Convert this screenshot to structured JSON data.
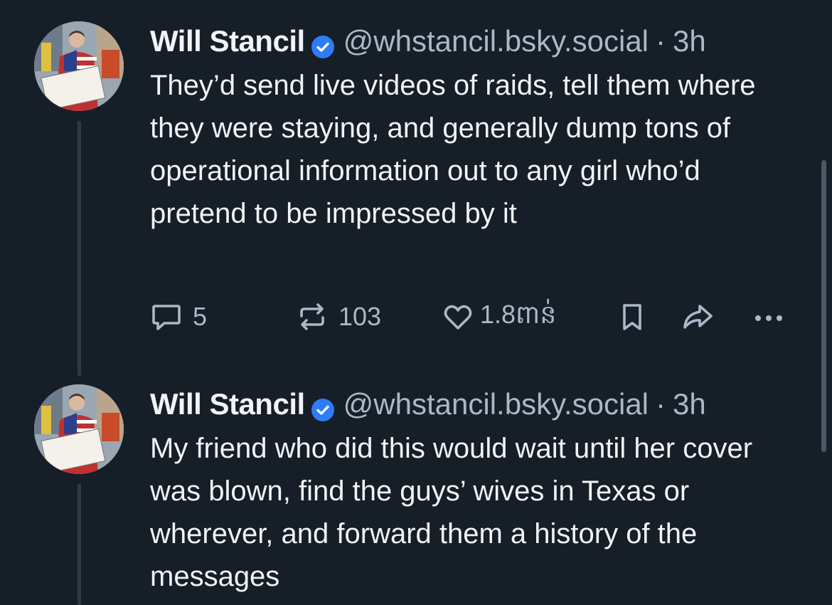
{
  "posts": [
    {
      "author": {
        "name": "Will Stancil",
        "handle": "@whstancil.bsky.social",
        "verified_icon": "verified-check-icon",
        "avatar_sign_text": "There are more of us than them"
      },
      "separator": "·",
      "time": "3h",
      "text": "They’d send live videos of raids, tell them where they were staying, and generally dump tons of operational information out to any girl who’d pretend to be impressed by it",
      "actions": {
        "replies": "5",
        "reposts": "103",
        "likes": "1.8ពាន់"
      }
    },
    {
      "author": {
        "name": "Will Stancil",
        "handle": "@whstancil.bsky.social",
        "verified_icon": "verified-check-icon",
        "avatar_sign_text": "There are more of us than them"
      },
      "separator": "·",
      "time": "3h",
      "text": "My friend who did this would wait until her cover was blown, find the guys’ wives in Texas or wherever, and forward them a history of the messages"
    }
  ],
  "colors": {
    "background": "#161e27",
    "text": "#f1f3f5",
    "muted": "#aab8c8",
    "verified": "#2f7cf6",
    "thread_line": "#2e3a48"
  },
  "icons": {
    "reply": "speech-bubble-icon",
    "repost": "repost-arrows-icon",
    "like": "heart-icon",
    "bookmark": "bookmark-icon",
    "share": "share-arrow-icon",
    "more": "more-dots-icon"
  }
}
